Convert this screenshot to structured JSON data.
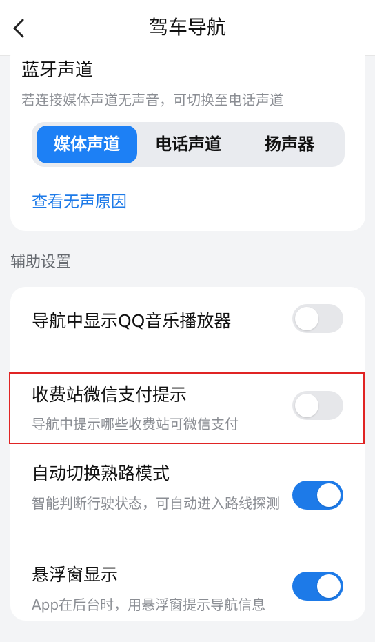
{
  "header": {
    "title": "驾车导航"
  },
  "bluetooth": {
    "title": "蓝牙声道",
    "description": "若连接媒体声道无声音，可切换至电话声道",
    "options": [
      "媒体声道",
      "电话声道",
      "扬声器"
    ],
    "selected": "媒体声道",
    "link": "查看无声原因"
  },
  "aux": {
    "section_label": "辅助设置",
    "items": [
      {
        "title": "导航中显示QQ音乐播放器",
        "description": "",
        "enabled": false
      },
      {
        "title": "收费站微信支付提示",
        "description": "导航中提示哪些收费站可微信支付",
        "enabled": false
      },
      {
        "title": "自动切换熟路模式",
        "description": "智能判断行驶状态，可自动进入路线探测",
        "enabled": true
      },
      {
        "title": "悬浮窗显示",
        "description": "App在后台时，用悬浮窗提示导航信息",
        "enabled": true
      }
    ]
  },
  "colors": {
    "accent": "#1d7ae8",
    "toggle_off": "#e6e7ea",
    "highlight": "#e02424"
  },
  "icons": {
    "back": "chevron-left-icon"
  }
}
